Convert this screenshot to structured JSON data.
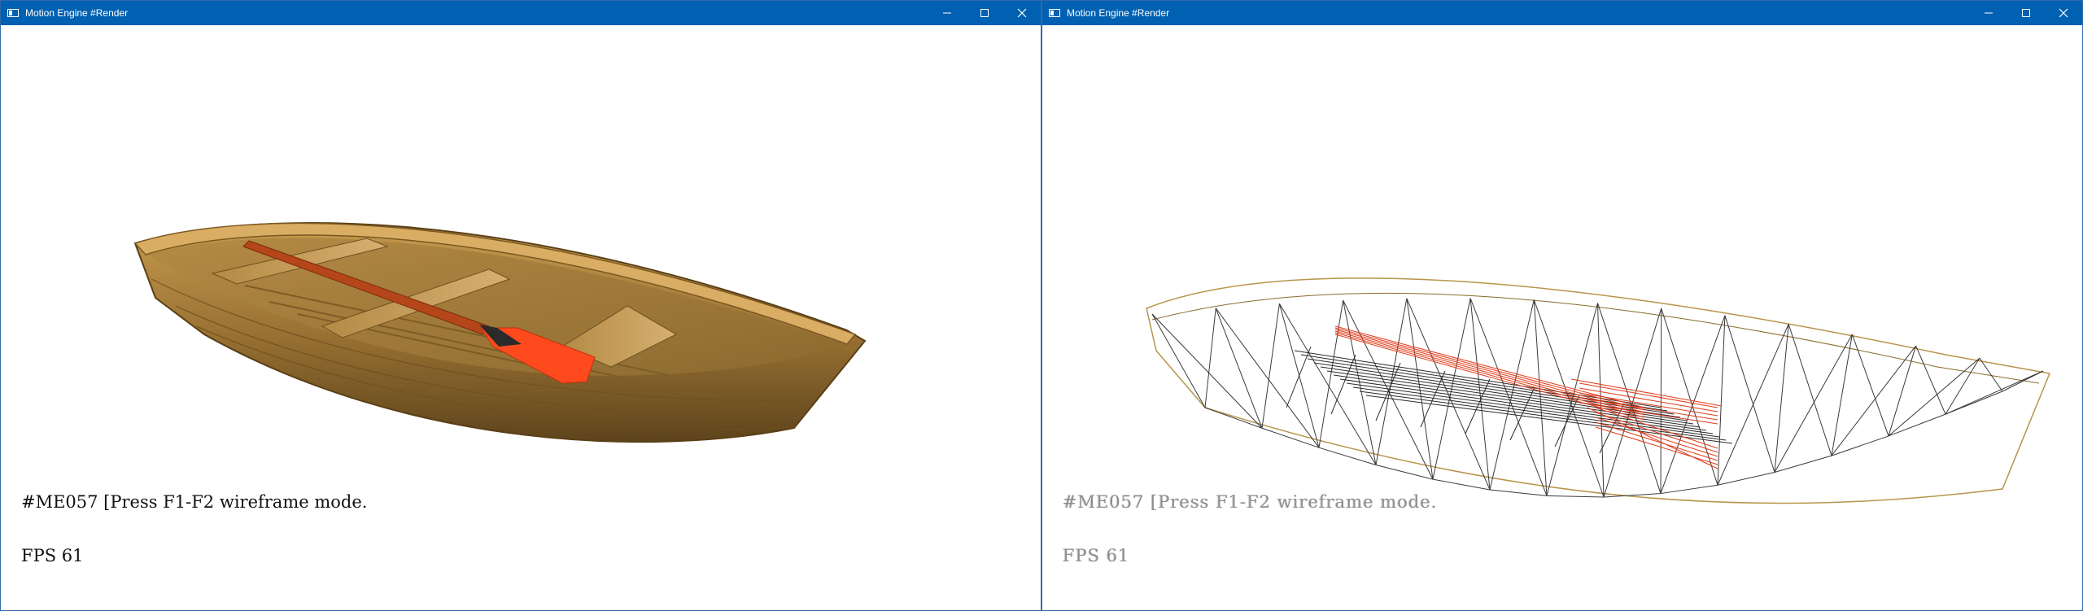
{
  "windows": [
    {
      "id": "left",
      "title": "Motion Engine #Render",
      "hud": {
        "line1": "#ME057 [Press F1-F2 wireframe mode.",
        "line2": "FPS 61"
      },
      "mode": "textured"
    },
    {
      "id": "right",
      "title": "Motion Engine #Render",
      "hud": {
        "line1": "#ME057 [Press F1-F2 wireframe mode.",
        "line2": "FPS 61"
      },
      "mode": "wireframe"
    }
  ],
  "captions": {
    "minimize": "minimize-icon",
    "maximize": "maximize-icon",
    "close": "close-icon"
  },
  "colors": {
    "titlebar": "#0061b2",
    "hull_wood": "#8a6a2c",
    "hull_wood_light": "#c4a05a",
    "paddle_shaft": "#b84a16",
    "paddle_blade": "#ff4a1e",
    "wire_dark": "#3a3a3a",
    "wire_tan": "#b8944a",
    "wire_red": "#e03a1a"
  }
}
